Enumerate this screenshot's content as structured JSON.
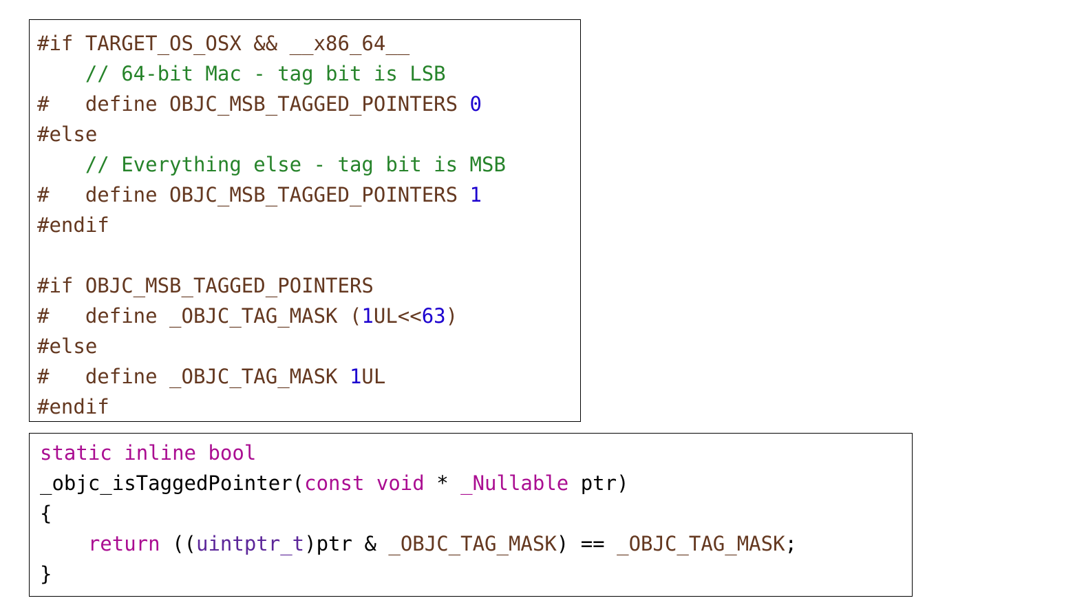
{
  "snippets": [
    {
      "lines": [
        [
          {
            "t": "#if TARGET_OS_OSX && __x86_64__",
            "k": "preproc"
          }
        ],
        [
          {
            "t": "    // 64-bit Mac - tag bit is LSB",
            "k": "comment"
          }
        ],
        [
          {
            "t": "#   define OBJC_MSB_TAGGED_POINTERS ",
            "k": "preproc"
          },
          {
            "t": "0",
            "k": "number"
          }
        ],
        [
          {
            "t": "#else",
            "k": "preproc"
          }
        ],
        [
          {
            "t": "    // Everything else - tag bit is MSB",
            "k": "comment"
          }
        ],
        [
          {
            "t": "#   define OBJC_MSB_TAGGED_POINTERS ",
            "k": "preproc"
          },
          {
            "t": "1",
            "k": "number"
          }
        ],
        [
          {
            "t": "#endif",
            "k": "preproc"
          }
        ],
        [],
        [
          {
            "t": "#if OBJC_MSB_TAGGED_POINTERS",
            "k": "preproc"
          }
        ],
        [
          {
            "t": "#   define _OBJC_TAG_MASK (",
            "k": "preproc"
          },
          {
            "t": "1",
            "k": "number"
          },
          {
            "t": "UL<<",
            "k": "preproc"
          },
          {
            "t": "63",
            "k": "number"
          },
          {
            "t": ")",
            "k": "preproc"
          }
        ],
        [
          {
            "t": "#else",
            "k": "preproc"
          }
        ],
        [
          {
            "t": "#   define _OBJC_TAG_MASK ",
            "k": "preproc"
          },
          {
            "t": "1",
            "k": "number"
          },
          {
            "t": "UL",
            "k": "preproc"
          }
        ],
        [
          {
            "t": "#endif",
            "k": "preproc"
          }
        ]
      ]
    },
    {
      "lines": [
        [
          {
            "t": "static",
            "k": "keyword"
          },
          {
            "t": " ",
            "k": "plain"
          },
          {
            "t": "inline",
            "k": "keyword"
          },
          {
            "t": " ",
            "k": "plain"
          },
          {
            "t": "bool",
            "k": "keyword"
          }
        ],
        [
          {
            "t": "_objc_isTaggedPointer(",
            "k": "plain"
          },
          {
            "t": "const",
            "k": "keyword"
          },
          {
            "t": " ",
            "k": "plain"
          },
          {
            "t": "void",
            "k": "keyword"
          },
          {
            "t": " * ",
            "k": "plain"
          },
          {
            "t": "_Nullable",
            "k": "keyword"
          },
          {
            "t": " ptr)",
            "k": "plain"
          }
        ],
        [
          {
            "t": "{",
            "k": "plain"
          }
        ],
        [
          {
            "t": "    ",
            "k": "plain"
          },
          {
            "t": "return",
            "k": "keyword"
          },
          {
            "t": " ((",
            "k": "plain"
          },
          {
            "t": "uintptr_t",
            "k": "type"
          },
          {
            "t": ")ptr & ",
            "k": "plain"
          },
          {
            "t": "_OBJC_TAG_MASK",
            "k": "macro"
          },
          {
            "t": ") == ",
            "k": "plain"
          },
          {
            "t": "_OBJC_TAG_MASK",
            "k": "macro"
          },
          {
            "t": ";",
            "k": "plain"
          }
        ],
        [
          {
            "t": "}",
            "k": "plain"
          }
        ]
      ]
    }
  ]
}
